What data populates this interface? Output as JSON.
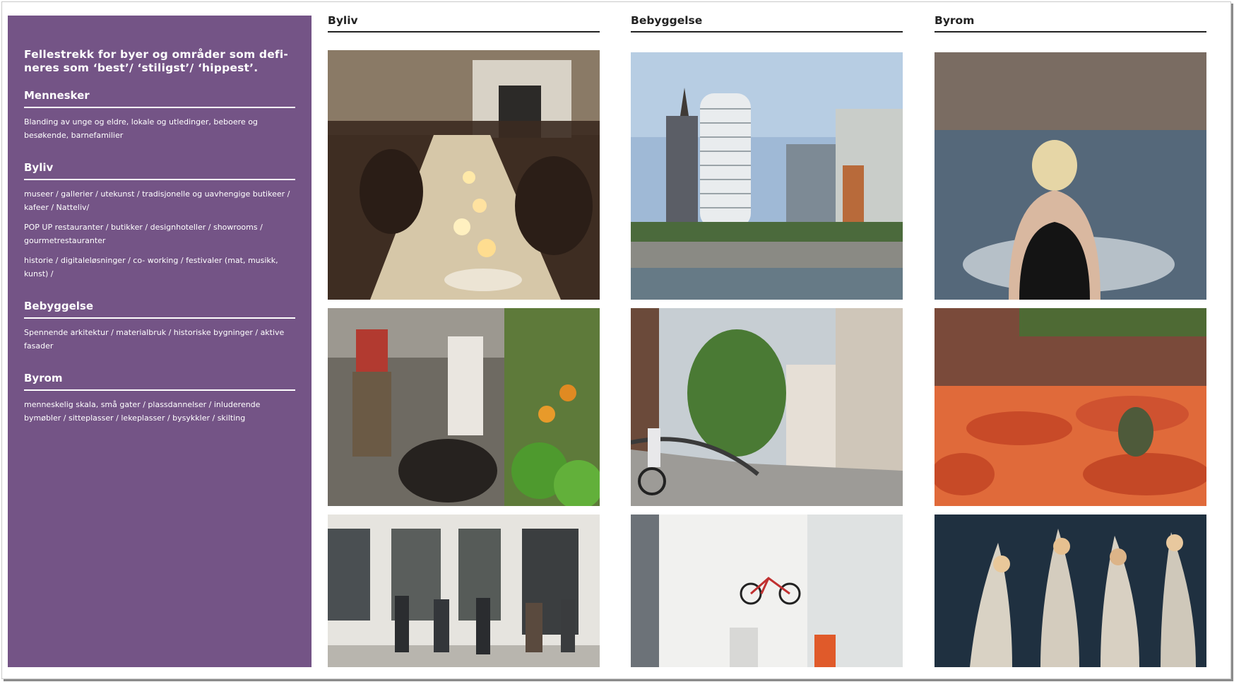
{
  "sidebar": {
    "lead": "Fellestrekk for byer og områder som defi-neres som ‘best’/ ‘stiligst’/ ‘hippest’.",
    "sections": [
      {
        "heading": "Mennesker",
        "paragraphs": [
          "Blanding av unge og eldre, lokale og utledinger, beboere og besøkende, barnefamilier"
        ]
      },
      {
        "heading": "Byliv",
        "paragraphs": [
          "museer / gallerier / utekunst / tradisjonelle og uavhengige butikeer / kafeer / Natteliv/",
          "POP UP  restauranter / butikker / designhoteller / showrooms / gourmetrestauranter",
          "historie / digitaleløsninger / co- working / festivaler (mat, musikk, kunst)  /"
        ]
      },
      {
        "heading": "Bebyggelse",
        "paragraphs": [
          "Spennende arkitektur /  materialbruk / historiske bygninger / aktive fasader"
        ]
      },
      {
        "heading": "Byrom",
        "paragraphs": [
          "menneskelig skala, små gater / plassdannelser / inluderende bymøbler / sitteplasser / lekeplasser / bysykkler / skilting"
        ]
      }
    ]
  },
  "columns": [
    {
      "heading": "Byliv",
      "photos": [
        "candlelit-long-table-dinner-photo",
        "market-produce-stall-photo",
        "shopfront-crowd-photo"
      ]
    },
    {
      "heading": "Bebyggelse",
      "photos": [
        "harbour-round-tower-photo",
        "cyclist-bridge-street-photo",
        "bike-showroom-interior-photo"
      ]
    },
    {
      "heading": "Byrom",
      "photos": [
        "harbour-bath-swimmers-photo",
        "orange-round-benches-photo",
        "canoe-picnic-photo"
      ]
    }
  ],
  "colors": {
    "sidebar_bg": "#745486",
    "rule": "#222222"
  }
}
